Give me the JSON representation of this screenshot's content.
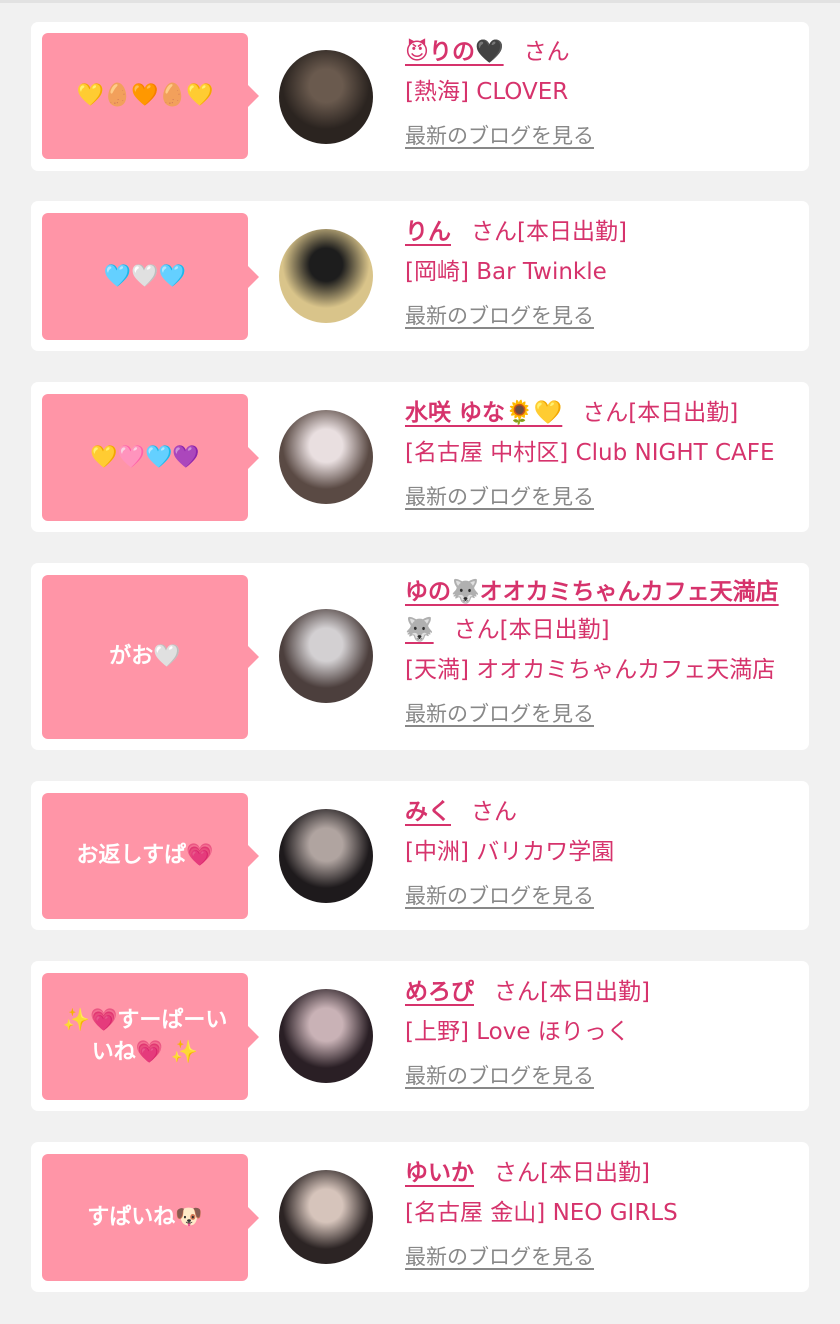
{
  "entries": [
    {
      "message": "💛🥚🧡🥚💛",
      "name": "😈りの🖤",
      "san": "さん",
      "status": "",
      "shop": "[熱海] CLOVER",
      "blog_link": "最新のブログを見る",
      "avatar_colors": [
        "#2b2420",
        "#6a5a4e"
      ]
    },
    {
      "message": "🩵🤍🩵",
      "name": "りん",
      "san": "さん",
      "status": "[本日出勤]",
      "shop": "[岡崎] Bar Twinkle",
      "blog_link": "最新のブログを見る",
      "avatar_colors": [
        "#d9c48a",
        "#1d1d1d"
      ]
    },
    {
      "message": "💛🩷🩵💜",
      "name": "水咲 ゆな🌻💛",
      "san": "さん",
      "status": "[本日出勤]",
      "shop": "[名古屋 中村区] Club NIGHT CAFE",
      "blog_link": "最新のブログを見る",
      "avatar_colors": [
        "#5a4a44",
        "#e9dfe0"
      ]
    },
    {
      "message": "がお🤍",
      "name": "ゆの🐺オオカミちゃんカフェ天満店🐺",
      "san": "さん",
      "status": "[本日出勤]",
      "shop": "[天満] オオカミちゃんカフェ天満店",
      "blog_link": "最新のブログを見る",
      "avatar_colors": [
        "#4c3f3d",
        "#d3d0d2"
      ]
    },
    {
      "message": "お返しすぱ💗",
      "name": "みく",
      "san": "さん",
      "status": "",
      "shop": "[中洲] バリカワ学園",
      "blog_link": "最新のブログを見る",
      "avatar_colors": [
        "#1e1a1c",
        "#b0a4a0"
      ]
    },
    {
      "message": "✨💗すーぱーいいね💗 ✨",
      "name": "めろぴ",
      "san": "さん",
      "status": "[本日出勤]",
      "shop": "[上野] Love ほりっく",
      "blog_link": "最新のブログを見る",
      "avatar_colors": [
        "#2a1f25",
        "#c9b2b6"
      ]
    },
    {
      "message": "すぱいね🐶",
      "name": "ゆいか",
      "san": "さん",
      "status": "[本日出勤]",
      "shop": "[名古屋 金山] NEO GIRLS",
      "blog_link": "最新のブログを見る",
      "avatar_colors": [
        "#2c2424",
        "#d6c4bb"
      ]
    }
  ]
}
